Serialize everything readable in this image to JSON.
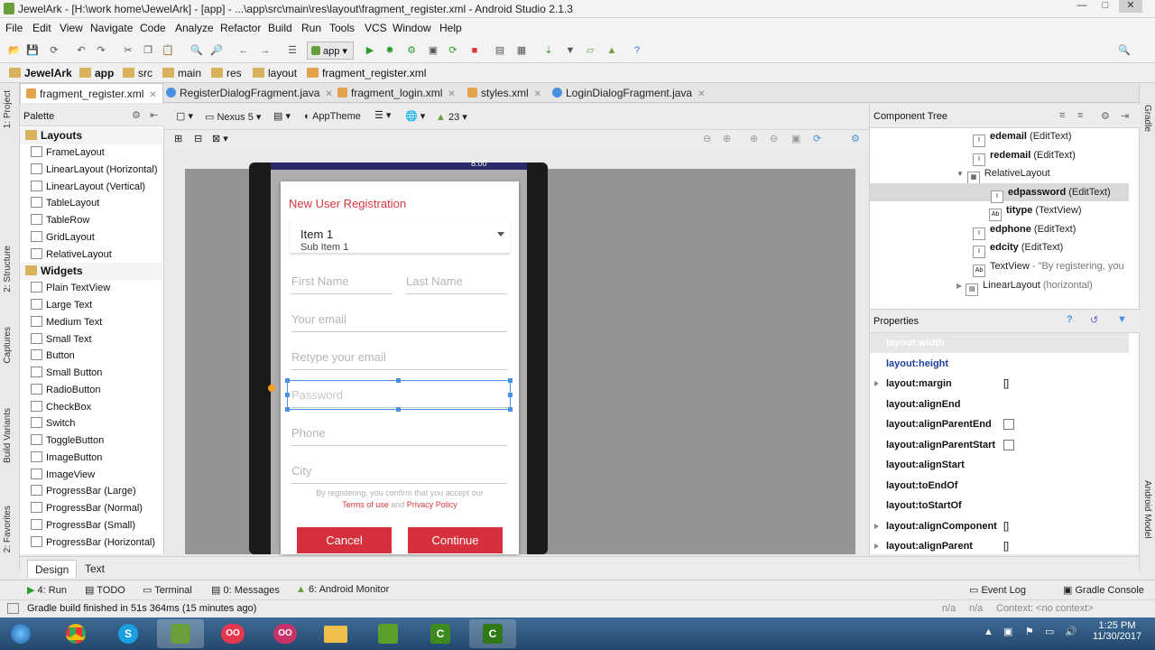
{
  "window": {
    "title": "JewelArk - [H:\\work home\\JewelArk] - [app] - ...\\app\\src\\main\\res\\layout\\fragment_register.xml - Android Studio 2.1.3"
  },
  "menu": [
    "File",
    "Edit",
    "View",
    "Navigate",
    "Code",
    "Analyze",
    "Refactor",
    "Build",
    "Run",
    "Tools",
    "VCS",
    "Window",
    "Help"
  ],
  "toolbar": {
    "run_config": "app"
  },
  "breadcrumbs": [
    "JewelArk",
    "app",
    "src",
    "main",
    "res",
    "layout",
    "fragment_register.xml"
  ],
  "editor_tabs": [
    {
      "label": "fragment_register.xml",
      "active": true
    },
    {
      "label": "RegisterDialogFragment.java"
    },
    {
      "label": "fragment_login.xml"
    },
    {
      "label": "styles.xml"
    },
    {
      "label": "LoginDialogFragment.java"
    }
  ],
  "left_tool_windows": [
    "1: Project",
    "2: Structure",
    "Captures",
    "Build Variants",
    "2: Favorites"
  ],
  "right_tool_windows": [
    "Gradle",
    "Android Model"
  ],
  "palette": {
    "title": "Palette",
    "groups": [
      {
        "name": "Layouts",
        "items": [
          "FrameLayout",
          "LinearLayout (Horizontal)",
          "LinearLayout (Vertical)",
          "TableLayout",
          "TableRow",
          "GridLayout",
          "RelativeLayout"
        ]
      },
      {
        "name": "Widgets",
        "items": [
          "Plain TextView",
          "Large Text",
          "Medium Text",
          "Small Text",
          "Button",
          "Small Button",
          "RadioButton",
          "CheckBox",
          "Switch",
          "ToggleButton",
          "ImageButton",
          "ImageView",
          "ProgressBar (Large)",
          "ProgressBar (Normal)",
          "ProgressBar (Small)",
          "ProgressBar (Horizontal)"
        ]
      }
    ]
  },
  "designer": {
    "device": "Nexus 5",
    "theme": "AppTheme",
    "api": "23",
    "phone_time": "8:00"
  },
  "dialog": {
    "title": "New User Registration",
    "spinner_item": "Item 1",
    "spinner_sub": "Sub Item 1",
    "first_name": "First Name",
    "last_name": "Last Name",
    "email": "Your email",
    "retype_email": "Retype your email",
    "password": "Password",
    "phone": "Phone",
    "city": "City",
    "terms_prefix": "By registering, you confirm that you accept our",
    "terms_link": "Terms of use",
    "and": "and",
    "privacy_link": "Privacy Policy",
    "cancel": "Cancel",
    "continue": "Continue",
    "accent": "#d5303c"
  },
  "component_tree": {
    "title": "Component Tree",
    "nodes": [
      {
        "id": "edemail",
        "type": "(EditText)"
      },
      {
        "id": "redemail",
        "type": "(EditText)"
      },
      {
        "id": "",
        "type": "RelativeLayout"
      },
      {
        "id": "edpassword",
        "type": "(EditText)"
      },
      {
        "id": "titype",
        "type": "(TextView)"
      },
      {
        "id": "edphone",
        "type": "(EditText)"
      },
      {
        "id": "edcity",
        "type": "(EditText)"
      },
      {
        "id": "",
        "type": "TextView",
        "extra": "- \"By registering, you"
      },
      {
        "id": "",
        "type": "LinearLayout",
        "extra": "(horizontal)"
      }
    ]
  },
  "properties": {
    "title": "Properties",
    "rows": [
      {
        "name": "layout:width",
        "value": ""
      },
      {
        "name": "layout:height",
        "value": ""
      },
      {
        "name": "layout:margin",
        "value": "[]"
      },
      {
        "name": "layout:alignEnd",
        "value": ""
      },
      {
        "name": "layout:alignParentEnd",
        "value": ""
      },
      {
        "name": "layout:alignParentStart",
        "value": ""
      },
      {
        "name": "layout:alignStart",
        "value": ""
      },
      {
        "name": "layout:toEndOf",
        "value": ""
      },
      {
        "name": "layout:toStartOf",
        "value": ""
      },
      {
        "name": "layout:alignComponent",
        "value": "[]"
      },
      {
        "name": "layout:alignParent",
        "value": "[]"
      }
    ]
  },
  "bottom_tabs": [
    "Design",
    "Text"
  ],
  "tool_windows": {
    "run": "4: Run",
    "todo": "TODO",
    "terminal": "Terminal",
    "messages": "0: Messages",
    "monitor": "6: Android Monitor",
    "event_log": "Event Log",
    "gradle_console": "Gradle Console"
  },
  "status": {
    "message": "Gradle build finished in 51s 364ms (15 minutes ago)",
    "na1": "n/a",
    "na2": "n/a",
    "context": "Context: <no context>"
  },
  "clock": {
    "time": "1:25 PM",
    "date": "11/30/2017"
  }
}
